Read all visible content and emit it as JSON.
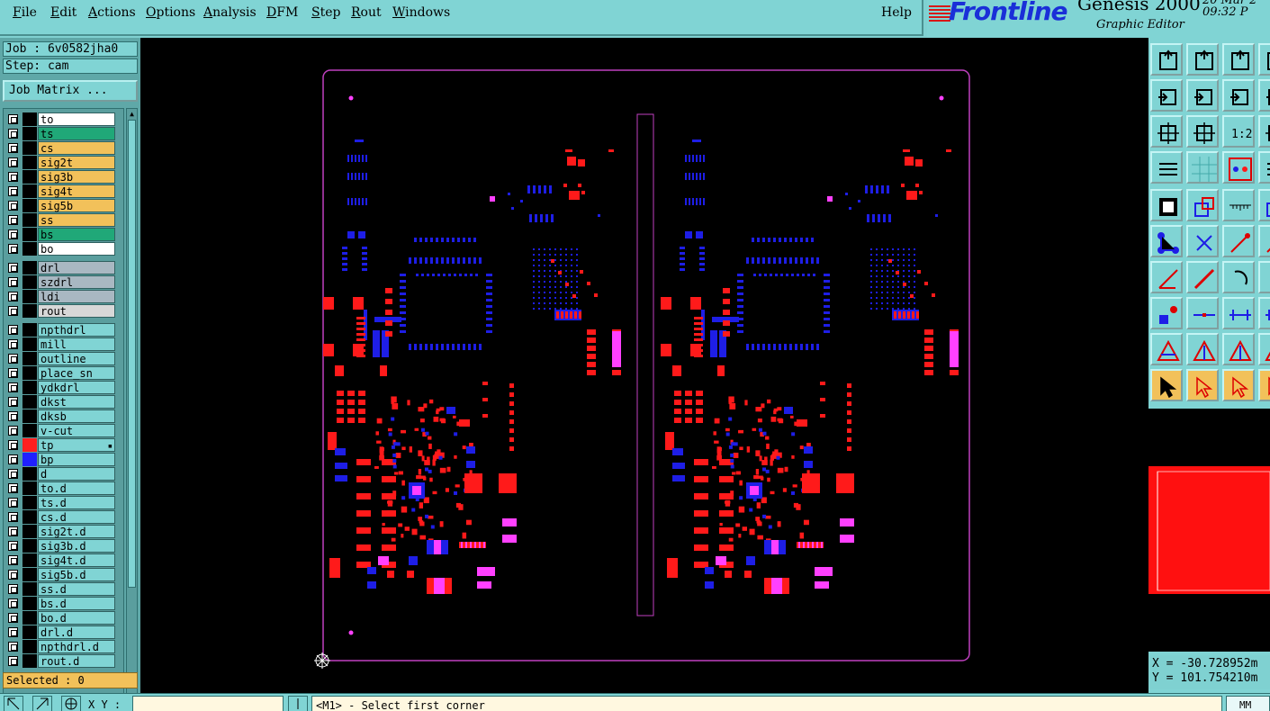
{
  "menu": {
    "items": [
      "File",
      "Edit",
      "Actions",
      "Options",
      "Analysis",
      "DFM",
      "Step",
      "Rout",
      "Windows"
    ],
    "help": "Help"
  },
  "brand": {
    "logo": "Frontline",
    "product": "Genesis 2000",
    "subtitle": "Graphic Editor",
    "date": "20 Mar 2",
    "time": "09:32 P"
  },
  "job": {
    "job_label": "Job : 6v0582jha0",
    "step_label": "Step: cam",
    "matrix_button": "Job Matrix ..."
  },
  "layers": [
    {
      "name": "to",
      "bg": "#ffffff",
      "swatch": "#000000"
    },
    {
      "name": "ts",
      "bg": "#20a878",
      "swatch": "#000000"
    },
    {
      "name": "cs",
      "bg": "#f2c15a",
      "swatch": "#000000"
    },
    {
      "name": "sig2t",
      "bg": "#f2c15a",
      "swatch": "#000000"
    },
    {
      "name": "sig3b",
      "bg": "#f2c15a",
      "swatch": "#000000"
    },
    {
      "name": "sig4t",
      "bg": "#f2c15a",
      "swatch": "#000000"
    },
    {
      "name": "sig5b",
      "bg": "#f2c15a",
      "swatch": "#000000"
    },
    {
      "name": "ss",
      "bg": "#f2c15a",
      "swatch": "#000000"
    },
    {
      "name": "bs",
      "bg": "#20a878",
      "swatch": "#000000"
    },
    {
      "name": "bo",
      "bg": "#ffffff",
      "swatch": "#000000"
    },
    {
      "name": "drl",
      "bg": "#a9b8c2",
      "swatch": "#000000",
      "gap": true
    },
    {
      "name": "szdrl",
      "bg": "#a9b8c2",
      "swatch": "#000000"
    },
    {
      "name": "ldi",
      "bg": "#a9b8c2",
      "swatch": "#000000"
    },
    {
      "name": "rout",
      "bg": "#d8d8d8",
      "swatch": "#000000"
    },
    {
      "name": "npthdrl",
      "bg": "#80d4d4",
      "swatch": "#000000",
      "gap": true
    },
    {
      "name": "mill",
      "bg": "#80d4d4",
      "swatch": "#000000"
    },
    {
      "name": "outline",
      "bg": "#80d4d4",
      "swatch": "#000000"
    },
    {
      "name": "place_sn",
      "bg": "#80d4d4",
      "swatch": "#000000"
    },
    {
      "name": "ydkdrl",
      "bg": "#80d4d4",
      "swatch": "#000000"
    },
    {
      "name": "dkst",
      "bg": "#80d4d4",
      "swatch": "#000000"
    },
    {
      "name": "dksb",
      "bg": "#80d4d4",
      "swatch": "#000000"
    },
    {
      "name": "v-cut",
      "bg": "#80d4d4",
      "swatch": "#000000"
    },
    {
      "name": "tp",
      "bg": "#80d4d4",
      "swatch": "#ff2020",
      "active": true
    },
    {
      "name": "bp",
      "bg": "#80d4d4",
      "swatch": "#2020ff"
    },
    {
      "name": "d",
      "bg": "#80d4d4",
      "swatch": "#000000"
    },
    {
      "name": "to.d",
      "bg": "#80d4d4",
      "swatch": "#000000"
    },
    {
      "name": "ts.d",
      "bg": "#80d4d4",
      "swatch": "#000000"
    },
    {
      "name": "cs.d",
      "bg": "#80d4d4",
      "swatch": "#000000"
    },
    {
      "name": "sig2t.d",
      "bg": "#80d4d4",
      "swatch": "#000000"
    },
    {
      "name": "sig3b.d",
      "bg": "#80d4d4",
      "swatch": "#000000"
    },
    {
      "name": "sig4t.d",
      "bg": "#80d4d4",
      "swatch": "#000000"
    },
    {
      "name": "sig5b.d",
      "bg": "#80d4d4",
      "swatch": "#000000"
    },
    {
      "name": "ss.d",
      "bg": "#80d4d4",
      "swatch": "#000000"
    },
    {
      "name": "bs.d",
      "bg": "#80d4d4",
      "swatch": "#000000"
    },
    {
      "name": "bo.d",
      "bg": "#80d4d4",
      "swatch": "#000000"
    },
    {
      "name": "drl.d",
      "bg": "#80d4d4",
      "swatch": "#000000"
    },
    {
      "name": "npthdrl.d",
      "bg": "#80d4d4",
      "swatch": "#000000"
    },
    {
      "name": "rout.d",
      "bg": "#80d4d4",
      "swatch": "#000000"
    }
  ],
  "selected_label": "Selected : 0",
  "toolbar": {
    "ratio_label": "1:2",
    "icons": [
      "zoom-in-icon",
      "zoom-out-icon",
      "home-icon",
      "pan-left-icon",
      "pan-right-icon",
      "undo-view-icon",
      "fit-icon",
      "zoom-center-icon",
      "ratio-icon",
      "settings-icon",
      "grid-icon",
      "layers-icon",
      "snap-icon",
      "draw-rect-icon",
      "measure-icon",
      "node-icon",
      "cross-icon",
      "connect-icon",
      "angle-icon",
      "line-icon",
      "rotate-icon",
      "pin-icon",
      "minus-icon",
      "dimension-icon",
      "triangle-icon",
      "arrow-a-icon",
      "arrow-b-icon",
      "select-icon",
      "select-box-icon",
      "select-circle-icon"
    ]
  },
  "coords": {
    "x": "X = -30.728952m",
    "y": "Y = 101.754210m"
  },
  "status": {
    "xy_label": "X Y :",
    "xy_value": "",
    "prompt": "<M1> - Select first corner",
    "units": "MM"
  },
  "colors": {
    "top_layer": "#ff1a1a",
    "bottom_layer": "#1e1ee6",
    "overlap": "#ff40ff",
    "outline": "#c040c0"
  }
}
